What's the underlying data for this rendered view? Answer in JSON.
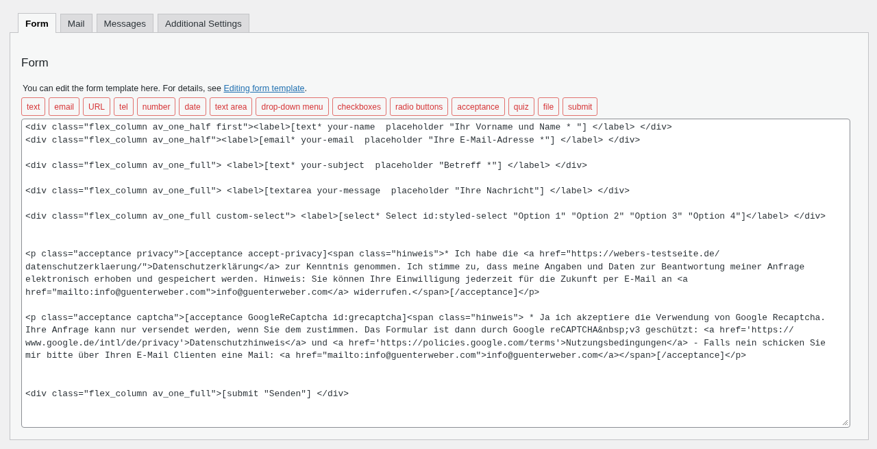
{
  "tabs": [
    {
      "label": "Form",
      "selected": true
    },
    {
      "label": "Mail",
      "selected": false
    },
    {
      "label": "Messages",
      "selected": false
    },
    {
      "label": "Additional Settings",
      "selected": false
    }
  ],
  "panel": {
    "heading": "Form",
    "description": "You can edit the form template here. For details, see ",
    "description_link": "Editing form template",
    "description_end": ".",
    "tag_buttons": [
      "text",
      "email",
      "URL",
      "tel",
      "number",
      "date",
      "text area",
      "drop-down menu",
      "checkboxes",
      "radio buttons",
      "acceptance",
      "quiz",
      "file",
      "submit"
    ],
    "template": {
      "value": "<div class=\"flex_column av_one_half first\"><label>[text* your-name  placeholder \"Ihr Vorname und Name * \"] </label> </div>\n<div class=\"flex_column av_one_half\"><label>[email* your-email  placeholder \"Ihre E-Mail-Adresse *\"] </label> </div>\n\n<div class=\"flex_column av_one_full\"> <label>[text* your-subject  placeholder \"Betreff *\"] </label> </div>\n\n<div class=\"flex_column av_one_full\"> <label>[textarea your-message  placeholder \"Ihre Nachricht\"] </label> </div>\n\n<div class=\"flex_column av_one_full custom-select\"> <label>[select* Select id:styled-select \"Option 1\" \"Option 2\" \"Option 3\" \"Option 4\"]</label> </div>\n\n\n<p class=\"acceptance privacy\">[acceptance accept-privacy]<span class=\"hinweis\">* Ich habe die <a href=\"https://webers-testseite.de/\ndatenschutzerklaerung/\">Datenschutzerklärung</a> zur Kenntnis genommen. Ich stimme zu, dass meine Angaben und Daten zur Beantwortung meiner Anfrage\nelektronisch erhoben und gespeichert werden. Hinweis: Sie können Ihre Einwilligung jederzeit für die Zukunft per E-Mail an <a\nhref=\"mailto:info@guenterweber.com\">info@guenterweber.com</a> widerrufen.</span>[/acceptance]</p>\n\n<p class=\"acceptance captcha\">[acceptance GoogleReCaptcha id:grecaptcha]<span class=\"hinweis\"> * Ja ich akzeptiere die Verwendung von Google Recaptcha.\nIhre Anfrage kann nur versendet werden, wenn Sie dem zustimmen. Das Formular ist dann durch Google reCAPTCHA&nbsp;v3 geschützt: <a href='https://\nwww.google.de/intl/de/privacy'>Datenschutzhinweis</a> und <a href='https://policies.google.com/terms'>Nutzungsbedingungen</a> - Falls nein schicken Sie\nmir bitte über Ihren E-Mail Clienten eine Mail: <a href=\"mailto:info@guenterweber.com\">info@guenterweber.com</a></span>[/acceptance]</p>\n\n\n<div class=\"flex_column av_one_full\">[submit \"Senden\"] </div>"
    }
  }
}
